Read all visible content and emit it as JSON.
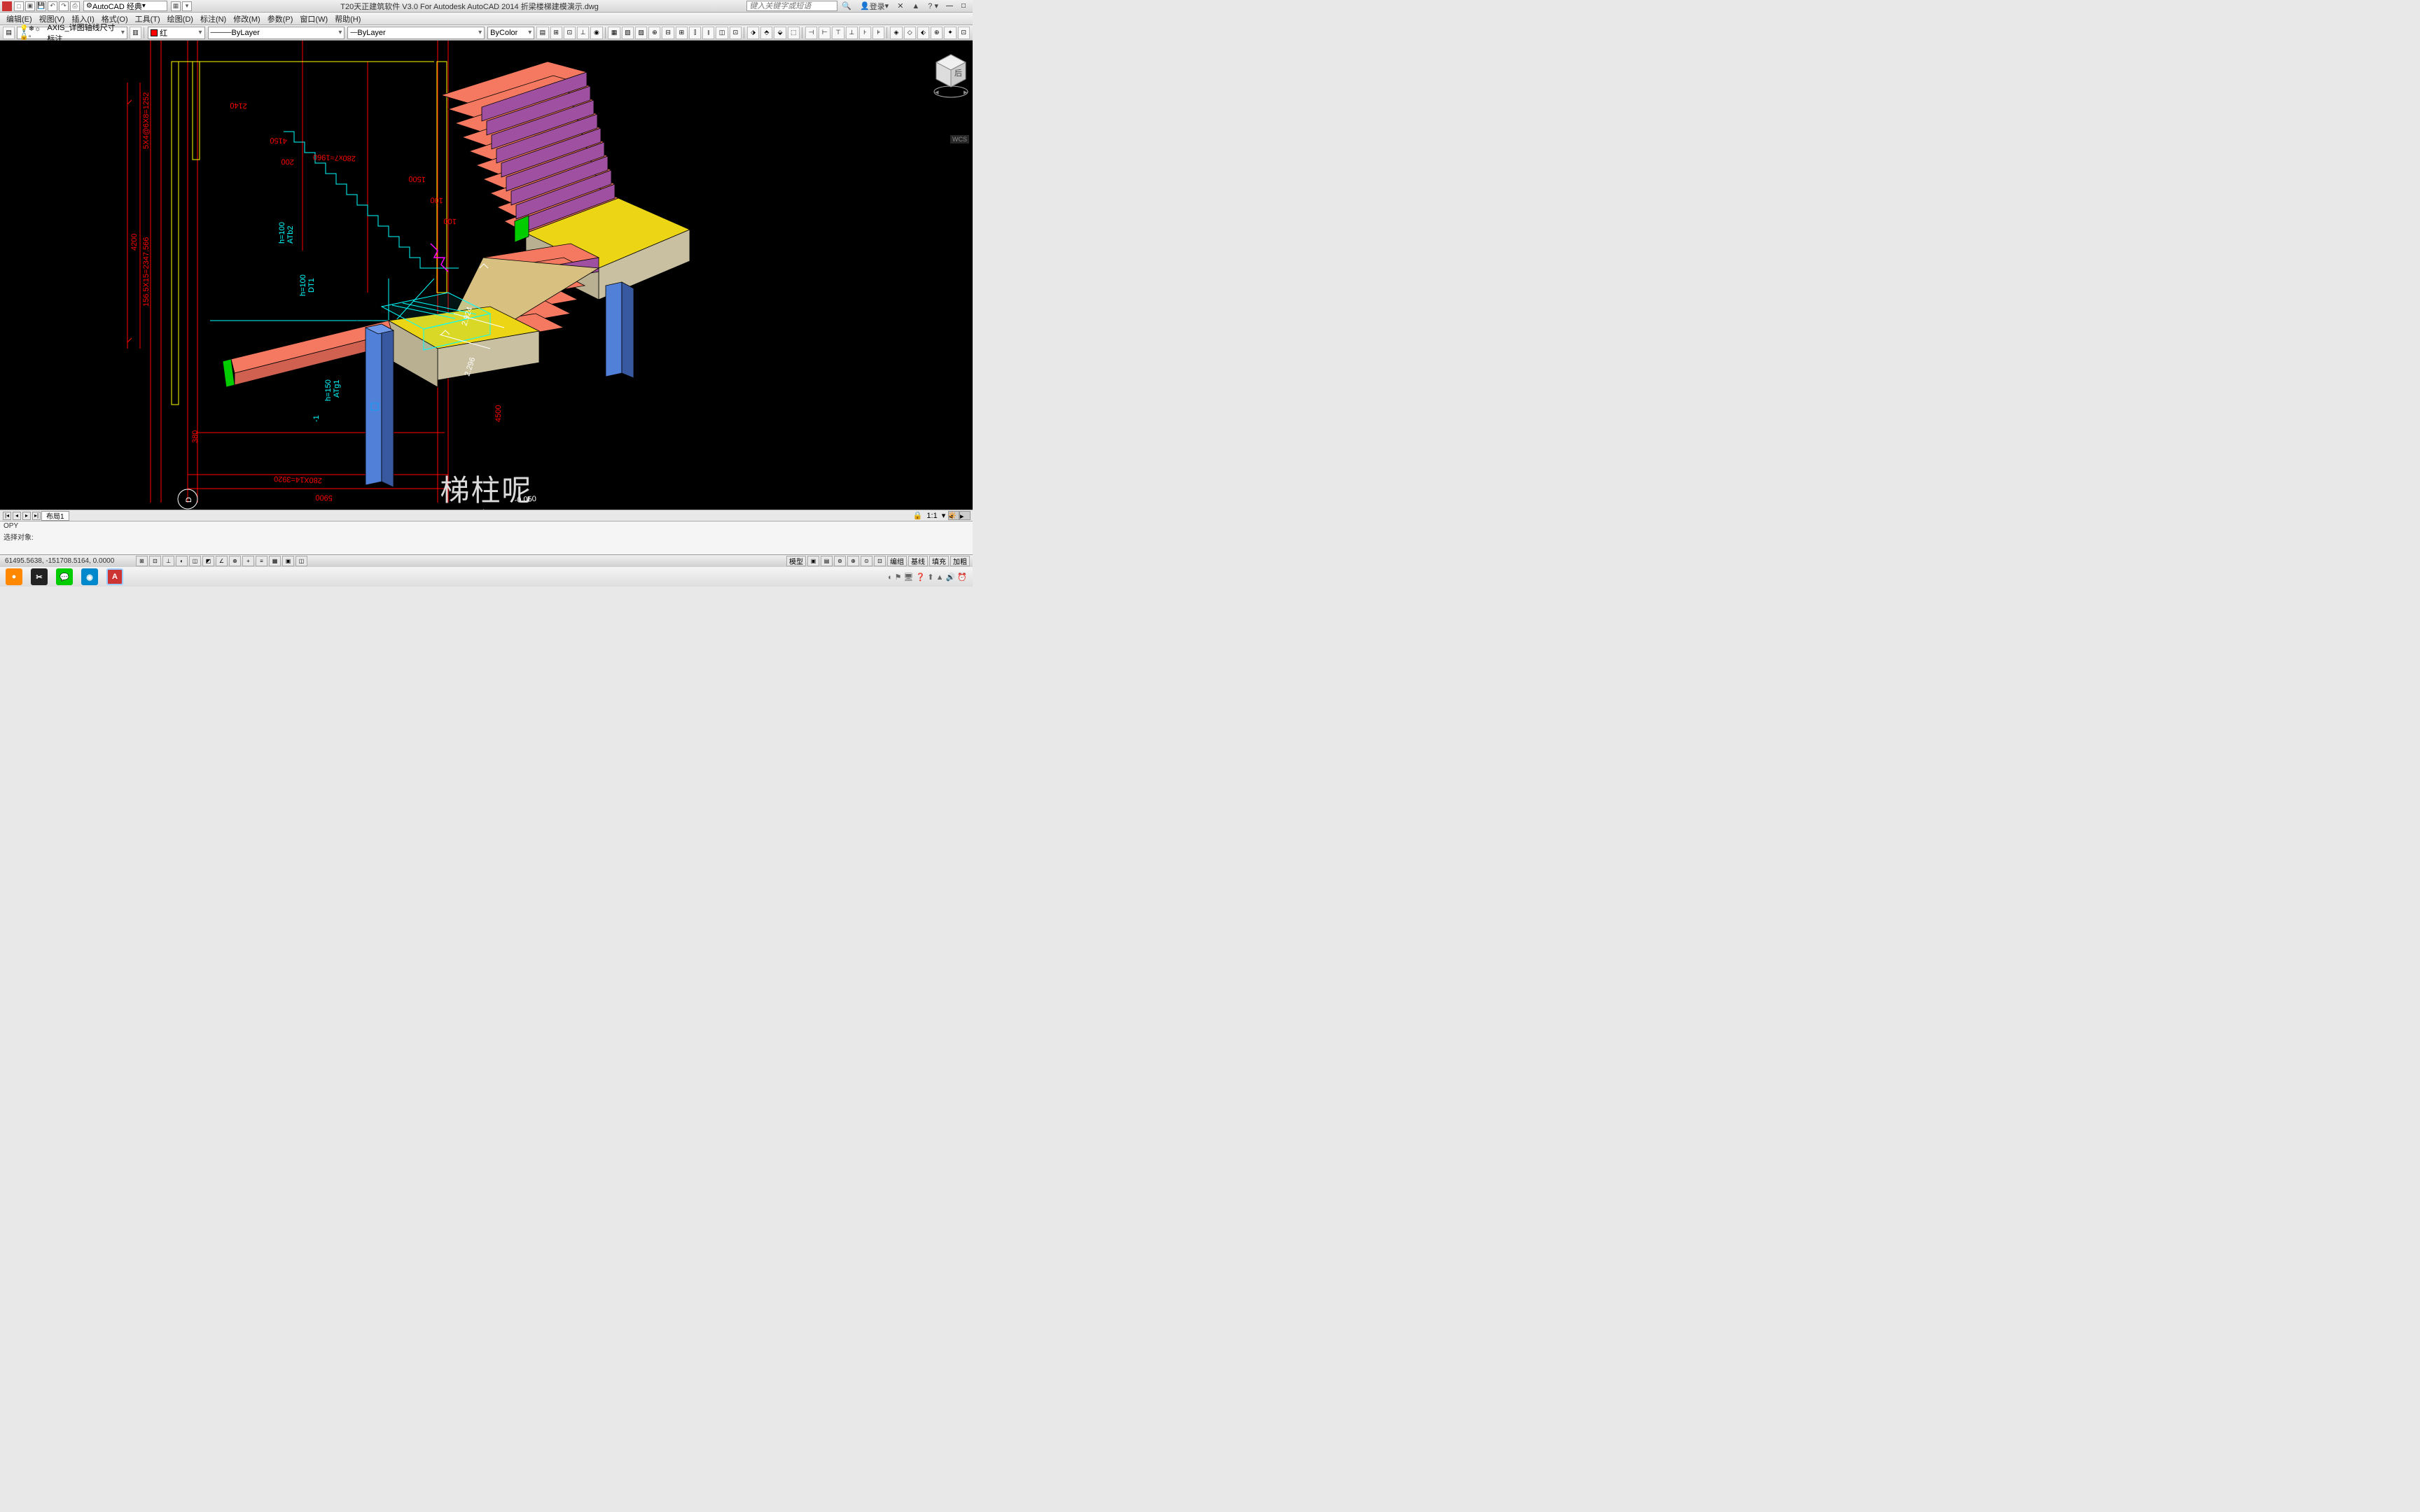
{
  "titlebar": {
    "workspace": "AutoCAD 经典",
    "title": "T20天正建筑软件 V3.0 For Autodesk AutoCAD 2014     折梁楼梯建模演示.dwg",
    "search_placeholder": "键入关键字或短语",
    "login": "登录"
  },
  "menubar": {
    "items": [
      "编辑(E)",
      "视图(V)",
      "插入(I)",
      "格式(O)",
      "工具(T)",
      "绘图(D)",
      "标注(N)",
      "修改(M)",
      "参数(P)",
      "窗口(W)",
      "帮助(H)"
    ]
  },
  "properties": {
    "layer": "AXIS_详图轴线尺寸标注",
    "color": "红",
    "linetype": "ByLayer",
    "lineweight": "ByLayer",
    "plotcolor": "ByColor"
  },
  "annotations": {
    "d1": "4200",
    "d2": "156.5X15=2347.566",
    "d2b": "5X4@6X8=1252",
    "d3": "2140",
    "d4": "4150",
    "d5": "200",
    "d6": "280x7=1960",
    "d7": "1500",
    "d8": "100",
    "d9": "100",
    "d10": "4500",
    "d11": "380",
    "d12": "280X14=3920",
    "d13": "5900",
    "d14": "2.924",
    "d15": "2.296",
    "d16": "-0.050",
    "l1": "ATb2\nh=100",
    "l2": "DT1\nh=100",
    "l3": "ATg1\nh=150",
    "l4": "-1",
    "axis": "D"
  },
  "viewcube": {
    "face": "后"
  },
  "wcs": "WCS",
  "subtitle": "梯柱呢",
  "tabs": {
    "active": "布局1"
  },
  "annoscale": "1:1",
  "command": {
    "line1": "OPY",
    "line2": "选择对象:"
  },
  "statusbar": {
    "coords": "61495.5638, -151708.5164, 0.0000",
    "rlabels": [
      "模型"
    ],
    "rtext": [
      "编组",
      "基线",
      "填充",
      "加粗"
    ]
  },
  "taskbar_apps": [
    "rec",
    "cap",
    "wechat",
    "browser",
    "autocad"
  ]
}
